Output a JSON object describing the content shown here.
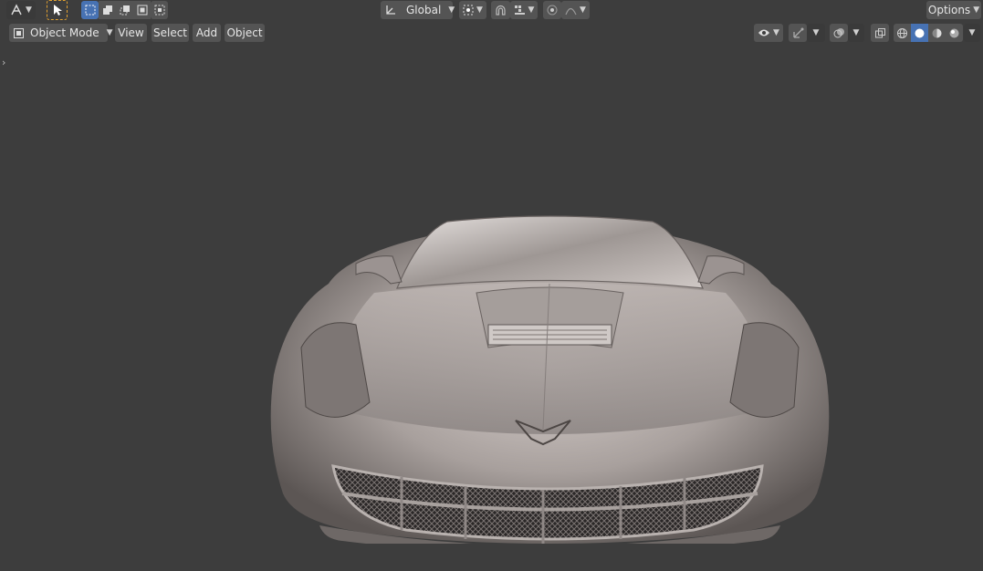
{
  "toolbar": {
    "orientation_label": "Global",
    "options_label": "Options"
  },
  "header": {
    "mode_label": "Object Mode",
    "menus": [
      "View",
      "Select",
      "Add",
      "Object"
    ]
  },
  "icons": {
    "editor_type": "tool-settings-icon",
    "select_tool": "cursor-select-icon",
    "select_modes": [
      "select-new-icon",
      "select-extend-icon",
      "select-subtract-icon",
      "select-invert-icon",
      "select-intersect-icon"
    ],
    "transform_orientation": "orientation-axes-icon",
    "pivot": "pivot-point-icon",
    "snap": "snap-magnet-icon",
    "snap_target": "snap-increment-icon",
    "proportional": "proportional-edit-icon",
    "falloff": "falloff-curve-icon",
    "visibility": "eye-visibility-icon",
    "gizmo": "gizmo-icon",
    "overlays": "overlays-icon",
    "xray": "xray-icon",
    "shading": [
      "wireframe-shading-icon",
      "solid-shading-icon",
      "material-preview-icon",
      "rendered-shading-icon"
    ]
  },
  "colors": {
    "header_bg": "#3d3d3d",
    "viewport_bg": "#3d3d3d",
    "button_bg": "#545454",
    "accent": "#4772b3",
    "car_paint": "#a49a98"
  },
  "viewport": {
    "subject": "car-model-icon"
  }
}
